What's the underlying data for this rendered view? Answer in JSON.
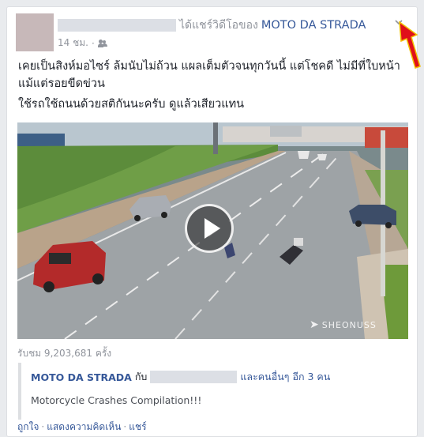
{
  "post": {
    "shared_text": "ได้แชร์วิดีโอของ",
    "page_name": "MOTO DA STRADA",
    "timestamp": "14 ชม.",
    "separator": "·",
    "audience_icon": "friends-icon",
    "options_icon": "chevron-down-icon",
    "message_line1": "เคยเป็นสิงห์มอไซร์ ล้มนับไม่ถ้วน แผลเต็มตัวจนทุกวันนี้ แต่โชคดี ไม่มีที่ใบหน้า แม้แต่รอยขีดข่วน",
    "message_line2": "ใช้รถใช้ถนนด้วยสติกันนะครับ ดูแล้วเสียวแทน"
  },
  "video": {
    "play_icon": "play-icon",
    "watermark": "SHEONUSS",
    "views": "รับชม 9,203,681 ครั้ง"
  },
  "shared_box": {
    "page_name": "MOTO DA STRADA",
    "with_text": "กับ",
    "others_text": "และคนอื่นๆ อีก 3 คน",
    "title": "Motorcycle Crashes Compilation!!!"
  },
  "actions": {
    "like": "ถูกใจ",
    "comment": "แสดงความคิดเห็น",
    "share": "แชร์",
    "separator": "·"
  },
  "colors": {
    "link": "#365899",
    "muted": "#90949c",
    "arrow": "#e0101a"
  }
}
